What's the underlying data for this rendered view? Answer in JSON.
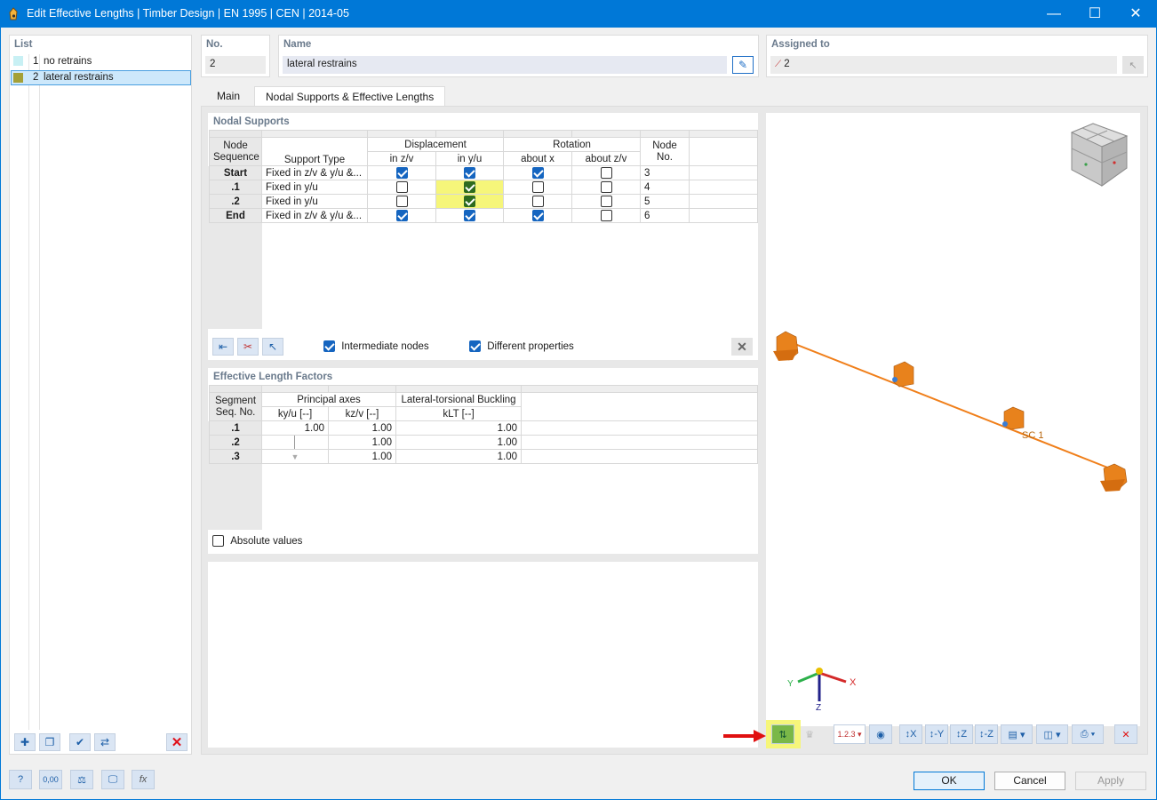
{
  "window": {
    "title": "Edit Effective Lengths | Timber Design | EN 1995 | CEN | 2014-05"
  },
  "list": {
    "header": "List",
    "items": [
      {
        "no": "1",
        "name": "no retrains",
        "color": "#c8f0f4"
      },
      {
        "no": "2",
        "name": "lateral restrains",
        "color": "#a4a037"
      }
    ]
  },
  "no_field": {
    "label": "No.",
    "value": "2"
  },
  "name_field": {
    "label": "Name",
    "value": "lateral restrains"
  },
  "assigned": {
    "label": "Assigned to",
    "value": "2"
  },
  "tabs": {
    "main": "Main",
    "nodal": "Nodal Supports & Effective Lengths"
  },
  "nodal": {
    "title": "Nodal Supports",
    "headers": {
      "node_seq_1": "Node",
      "node_seq_2": "Sequence",
      "support_type": "Support Type",
      "displacement": "Displacement",
      "disp_z": "in z/v",
      "disp_y": "in y/u",
      "rotation": "Rotation",
      "rot_x": "about x",
      "rot_z": "about z/v",
      "node_no_1": "Node",
      "node_no_2": "No."
    },
    "rows": [
      {
        "seq": "Start",
        "type": "Fixed in z/v & y/u &...",
        "dz": true,
        "dy": true,
        "rx": true,
        "rz": false,
        "node": "3"
      },
      {
        "seq": ".1",
        "type": "Fixed in y/u",
        "dz": false,
        "dy": true,
        "rx": false,
        "rz": false,
        "node": "4"
      },
      {
        "seq": ".2",
        "type": "Fixed in y/u",
        "dz": false,
        "dy": true,
        "rx": false,
        "rz": false,
        "node": "5"
      },
      {
        "seq": "End",
        "type": "Fixed in z/v & y/u &...",
        "dz": true,
        "dy": true,
        "rx": true,
        "rz": false,
        "node": "6"
      }
    ],
    "intermediate_nodes": "Intermediate nodes",
    "different_properties": "Different properties"
  },
  "elf": {
    "title": "Effective Length Factors",
    "headers": {
      "seg_1": "Segment",
      "seg_2": "Seq. No.",
      "principal": "Principal axes",
      "ky": "ky/u [--]",
      "kz": "kz/v [--]",
      "ltb": "Lateral-torsional Buckling",
      "klt": "kLT [--]"
    },
    "rows": [
      {
        "seg": ".1",
        "ky": "1.00",
        "kz": "1.00",
        "klt": "1.00"
      },
      {
        "seg": ".2",
        "ky": "",
        "kz": "1.00",
        "klt": "1.00"
      },
      {
        "seg": ".3",
        "ky": "",
        "kz": "1.00",
        "klt": "1.00"
      }
    ],
    "absolute_values": "Absolute values"
  },
  "view": {
    "member_label": "SC 1",
    "axis_x": "X",
    "axis_y": "Y",
    "axis_z": "Z",
    "member_color": "#f07f1a",
    "support_color": "#e8821c"
  },
  "buttons": {
    "ok": "OK",
    "cancel": "Cancel",
    "apply": "Apply"
  },
  "bottom_icons": {
    "decimals": "0,00"
  }
}
